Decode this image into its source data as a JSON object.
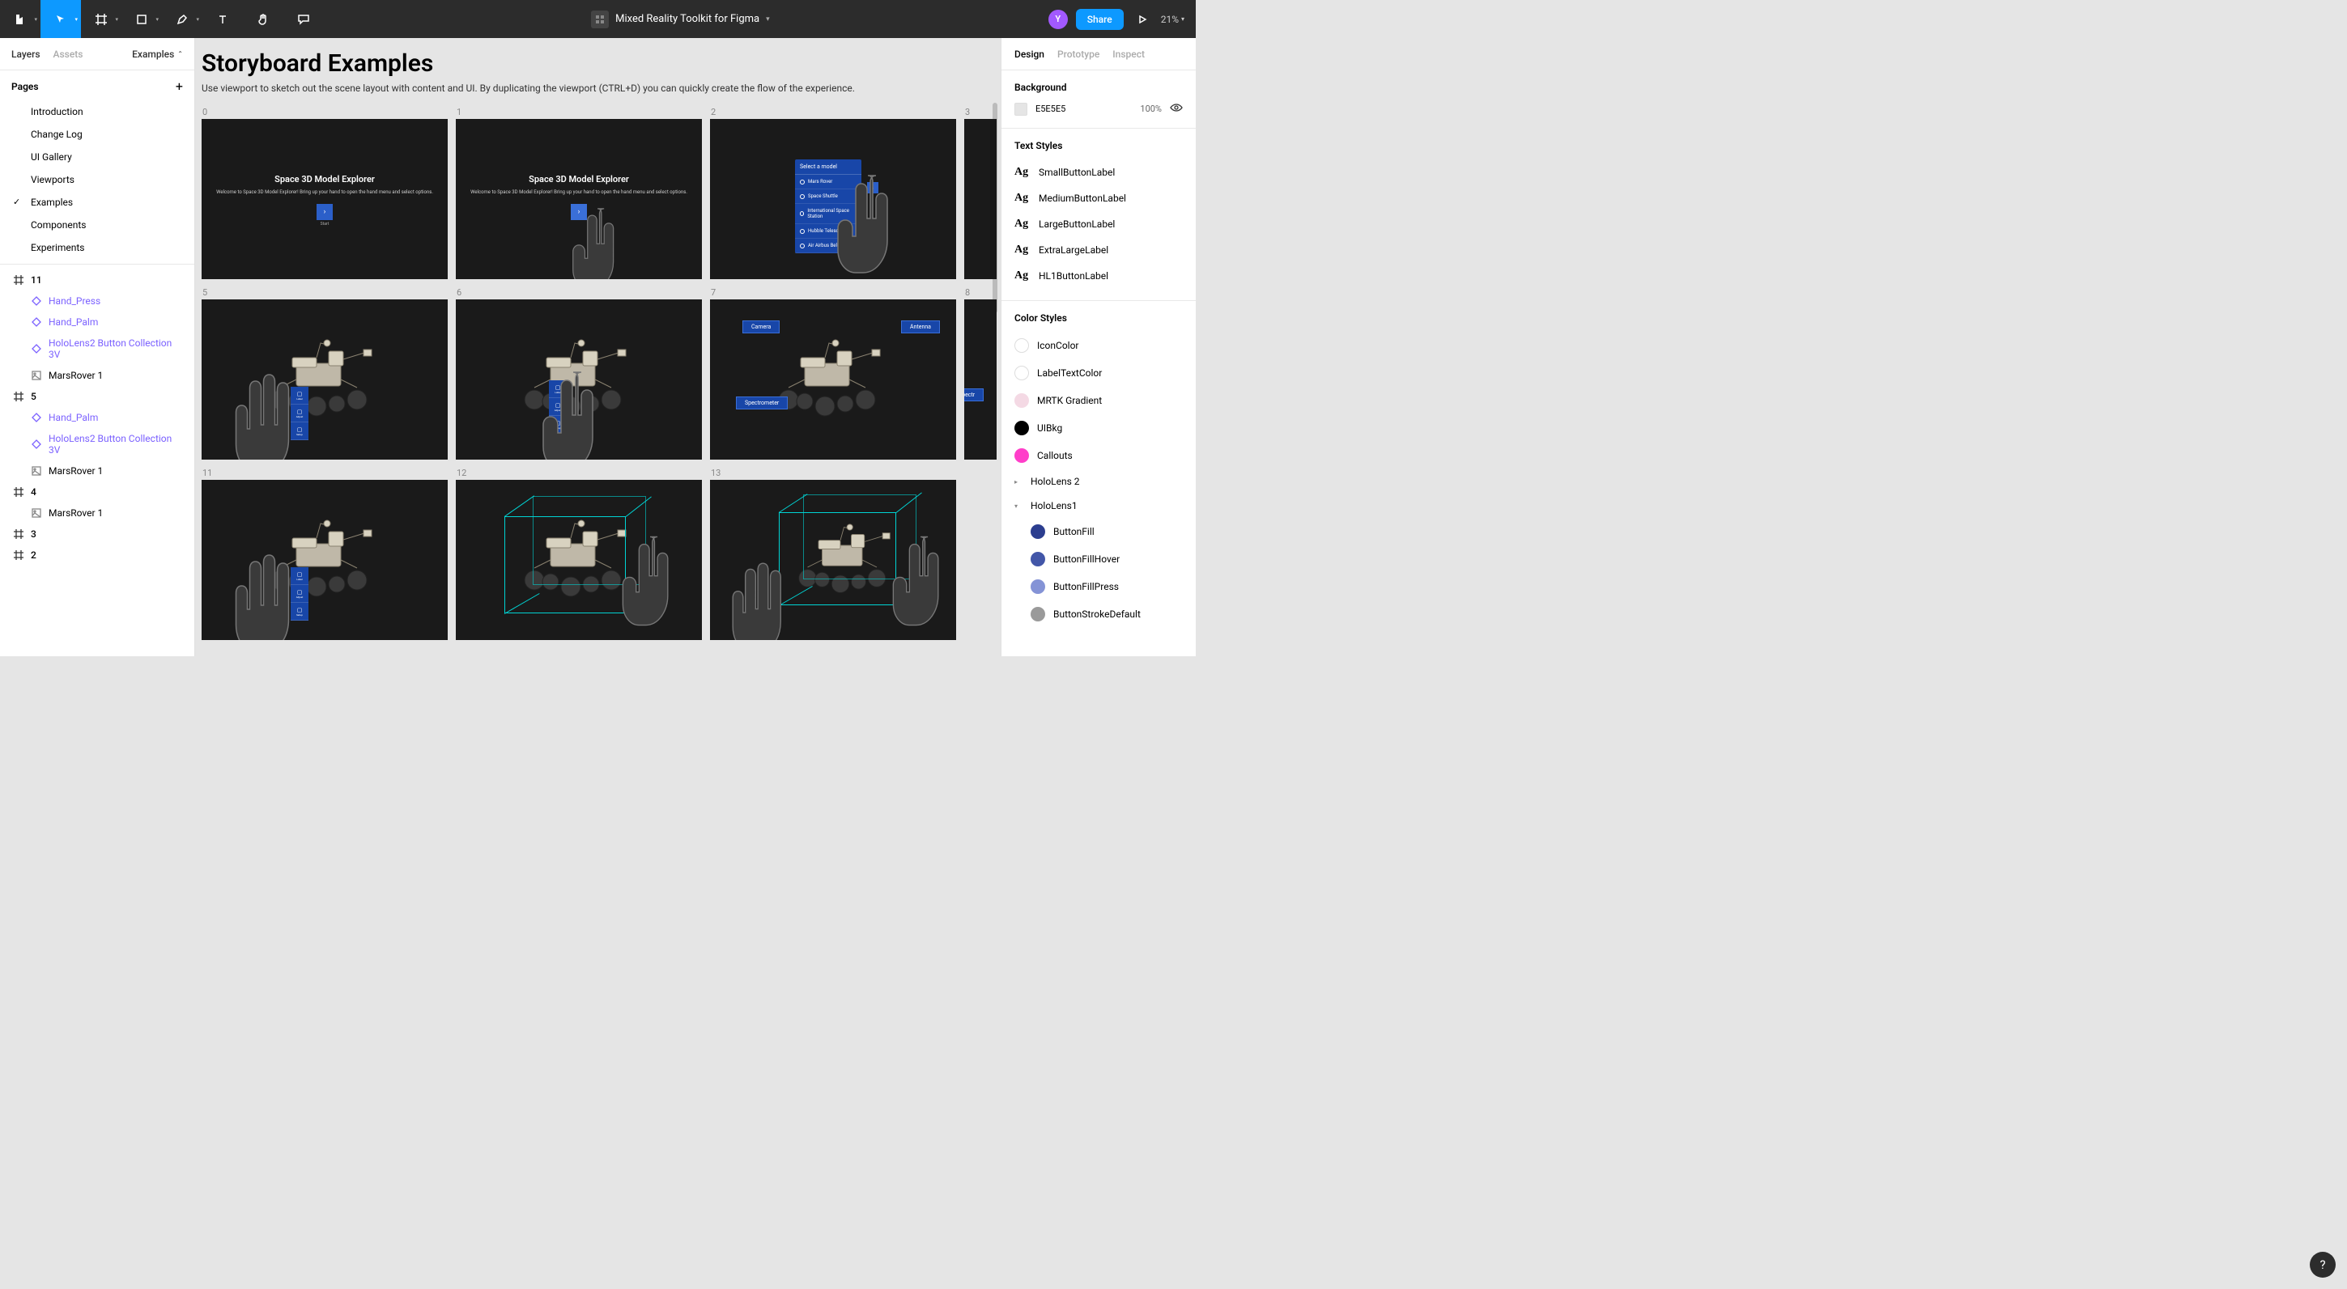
{
  "topbar": {
    "file_title": "Mixed Reality Toolkit for Figma",
    "avatar_initial": "Y",
    "share_label": "Share",
    "zoom": "21%"
  },
  "left": {
    "tabs": {
      "layers": "Layers",
      "assets": "Assets",
      "page_dd": "Examples"
    },
    "pages_header": "Pages",
    "pages": [
      "Introduction",
      "Change Log",
      "UI Gallery",
      "Viewports",
      "Examples",
      "Components",
      "Experiments"
    ],
    "selected_page": "Examples",
    "layers": [
      {
        "type": "frame",
        "name": "11"
      },
      {
        "type": "comp",
        "name": "Hand_Press"
      },
      {
        "type": "comp",
        "name": "Hand_Palm"
      },
      {
        "type": "comp",
        "name": "HoloLens2 Button Collection 3V"
      },
      {
        "type": "image",
        "name": "MarsRover 1"
      },
      {
        "type": "frame",
        "name": "5"
      },
      {
        "type": "comp",
        "name": "Hand_Palm"
      },
      {
        "type": "comp",
        "name": "HoloLens2 Button Collection 3V"
      },
      {
        "type": "image",
        "name": "MarsRover 1"
      },
      {
        "type": "frame",
        "name": "4"
      },
      {
        "type": "image",
        "name": "MarsRover 1"
      },
      {
        "type": "frame",
        "name": "3"
      },
      {
        "type": "frame",
        "name": "2"
      }
    ]
  },
  "canvas": {
    "title": "Storyboard Examples",
    "subtitle": "Use viewport to sketch out the scene layout with content and UI. By duplicating the viewport (CTRL+D) you can quickly create the flow of the experience.",
    "frame_labels": [
      "0",
      "1",
      "2",
      "3",
      "5",
      "6",
      "7",
      "8",
      "11",
      "12",
      "13"
    ],
    "intro_title": "Space 3D Model Explorer",
    "intro_sub": "Welcome to Space 3D Model Explorer! Bring up your hand to open the hand menu and select options.",
    "intro_btn_label": "Start",
    "menu_header": "Select a model",
    "menu_options": [
      "Mars Rover",
      "Space Shuttle",
      "International Space Station",
      "Hubble Telescope",
      "Air Airbus Beluga"
    ],
    "btncol": [
      "Label",
      "Adjust",
      "Setup"
    ],
    "callouts": {
      "camera": "Camera",
      "antenna": "Antenna",
      "spectrometer": "Spectrometer"
    }
  },
  "right": {
    "tabs": {
      "design": "Design",
      "prototype": "Prototype",
      "inspect": "Inspect"
    },
    "background_label": "Background",
    "bg_hex": "E5E5E5",
    "bg_opacity": "100%",
    "text_styles_label": "Text Styles",
    "text_styles": [
      "SmallButtonLabel",
      "MediumButtonLabel",
      "LargeButtonLabel",
      "ExtraLargeLabel",
      "HL1ButtonLabel"
    ],
    "color_styles_label": "Color Styles",
    "color_styles": [
      {
        "name": "IconColor",
        "hex": "#ffffff",
        "outline": true
      },
      {
        "name": "LabelTextColor",
        "hex": "#ffffff",
        "outline": true
      },
      {
        "name": "MRTK Gradient",
        "hex": "#f4d9e4"
      },
      {
        "name": "UIBkg",
        "hex": "#000000"
      },
      {
        "name": "Callouts",
        "hex": "#ff3ec9"
      },
      {
        "name": "HoloLens 2",
        "group": true,
        "open": false
      },
      {
        "name": "HoloLens1",
        "group": true,
        "open": true
      },
      {
        "name": "ButtonFill",
        "hex": "#2c3e8f",
        "indent": true
      },
      {
        "name": "ButtonFillHover",
        "hex": "#4256a8",
        "indent": true
      },
      {
        "name": "ButtonFillPress",
        "hex": "#8493d6",
        "indent": true
      },
      {
        "name": "ButtonStrokeDefault",
        "hex": "#9a9a9a",
        "indent": true
      }
    ]
  }
}
